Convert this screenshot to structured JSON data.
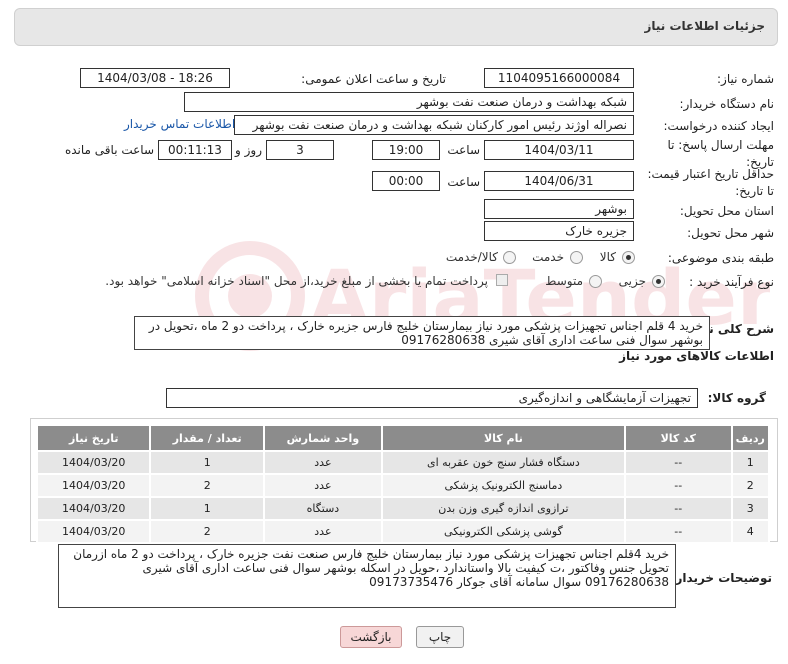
{
  "header": {
    "title": "جزئیات اطلاعات نیاز"
  },
  "need_number": {
    "label": "شماره نیاز:",
    "value": "1104095166000084"
  },
  "announce": {
    "label": "تاریخ و ساعت اعلان عمومی:",
    "value": "1404/03/08 - 18:26"
  },
  "buyer_org": {
    "label": "نام دستگاه خریدار:",
    "value": "شبکه بهداشت و درمان صنعت نفت بوشهر"
  },
  "requester": {
    "label": "ایجاد کننده درخواست:",
    "value": "نصراله اوژند رئیس امور کارکنان شبکه بهداشت و درمان صنعت نفت بوشهر",
    "contact_link": "اطلاعات تماس خریدار"
  },
  "deadline": {
    "label": "مهلت ارسال پاسخ: تا تاریخ:",
    "date": "1404/03/11",
    "time_label": "ساعت",
    "time": "19:00",
    "days": "3",
    "days_label": "روز و",
    "remaining": "00:11:13",
    "remaining_label": "ساعت باقی مانده"
  },
  "price_validity": {
    "label": "حداقل تاریخ اعتبار قیمت: تا تاریخ:",
    "date": "1404/06/31",
    "time_label": "ساعت",
    "time": "00:00"
  },
  "province": {
    "label": "استان محل تحویل:",
    "value": "بوشهر"
  },
  "city": {
    "label": "شهر محل تحویل:",
    "value": "جزیره خارک"
  },
  "category": {
    "label": "طبقه بندی موضوعی:",
    "options": [
      "کالا",
      "خدمت",
      "کالا/خدمت"
    ],
    "selected": "کالا"
  },
  "purchase_type": {
    "label": "نوع فرآیند خرید :",
    "options": [
      "جزیی",
      "متوسط"
    ],
    "selected": "جزیی",
    "note": "پرداخت تمام یا بخشی از مبلغ خرید،از محل \"اسناد خزانه اسلامی\" خواهد بود."
  },
  "summary": {
    "label": "شرح کلی نیاز:",
    "text": "خرید 4 قلم اجناس  تجهیزات  پزشکی مورد نیاز بیمارستان خلیج فارس  جزیره خارک ، پرداخت دو 2 ماه ،تحویل در بوشهر سوال فنی ساعت اداری آقای شیری 09176280638"
  },
  "items_section": {
    "title": "اطلاعات کالاهای مورد نیاز"
  },
  "goods_group": {
    "label": "گروه کالا:",
    "value": "تجهیزات آزمایشگاهی و اندازه‌گیری"
  },
  "table": {
    "headers": [
      "ردیف",
      "کد کالا",
      "نام کالا",
      "واحد شمارش",
      "تعداد / مقدار",
      "تاریخ نیاز"
    ],
    "rows": [
      [
        "1",
        "--",
        "دستگاه فشار سنج خون عقربه ای",
        "عدد",
        "1",
        "1404/03/20"
      ],
      [
        "2",
        "--",
        "دماسنج الکترونیک پزشکی",
        "عدد",
        "2",
        "1404/03/20"
      ],
      [
        "3",
        "--",
        "ترازوی اندازه گیری وزن بدن",
        "دستگاه",
        "1",
        "1404/03/20"
      ],
      [
        "4",
        "--",
        "گوشی پزشکی الکترونیکی",
        "عدد",
        "2",
        "1404/03/20"
      ]
    ]
  },
  "buyer_notes": {
    "label": "توضیحات خریدار:",
    "text": "خرید 4قلم اجناس  تجهیزات  پزشکی مورد نیاز بیمارستان خلیج فارس صنعت نفت جزیره خارک ، پرداخت دو 2 ماه  ازرمان تحویل جنس وفاکتور ،ت کیفیت بالا واستاندارد ،حویل در اسکله بوشهر سوال فنی ساعت اداری آقای شیری 09176280638 سوال سامانه  آقای جوکار 09173735476"
  },
  "buttons": {
    "print": "چاپ",
    "back": "بازگشت"
  },
  "colors": {
    "header_bg": "#e7e7e7",
    "table_header": "#8c8c8c",
    "link": "#1a57a8",
    "back_btn": "#f7d7d7"
  }
}
